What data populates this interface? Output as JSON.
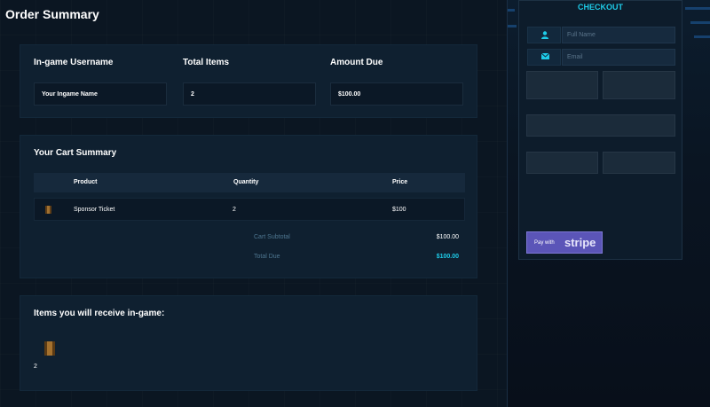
{
  "page": {
    "title": "Order Summary"
  },
  "summary": {
    "username_label": "In-game Username",
    "username_value": "Your Ingame Name",
    "items_label": "Total Items",
    "items_value": "2",
    "amount_label": "Amount Due",
    "amount_value": "$100.00"
  },
  "cart": {
    "title": "Your Cart Summary",
    "headers": {
      "product": "Product",
      "quantity": "Quantity",
      "price": "Price"
    },
    "rows": [
      {
        "icon": "ticket-icon",
        "product": "Sponsor Ticket",
        "quantity": "2",
        "price": "$100"
      }
    ],
    "subtotal_label": "Cart Subtotal",
    "subtotal_value": "$100.00",
    "total_label": "Total Due",
    "total_value": "$100.00"
  },
  "rewards": {
    "title": "Items you will receive in-game:",
    "items": [
      {
        "icon": "ticket-icon",
        "quantity": "2"
      }
    ]
  },
  "checkout": {
    "title": "CHECKOUT",
    "name_placeholder": "Full Name",
    "email_placeholder": "Email",
    "pay_with": "Pay with",
    "stripe": "stripe"
  },
  "colors": {
    "accent": "#1ecbe8",
    "background": "#0b1622",
    "card": "#0f2030",
    "stripe_button": "#5b55b8"
  }
}
